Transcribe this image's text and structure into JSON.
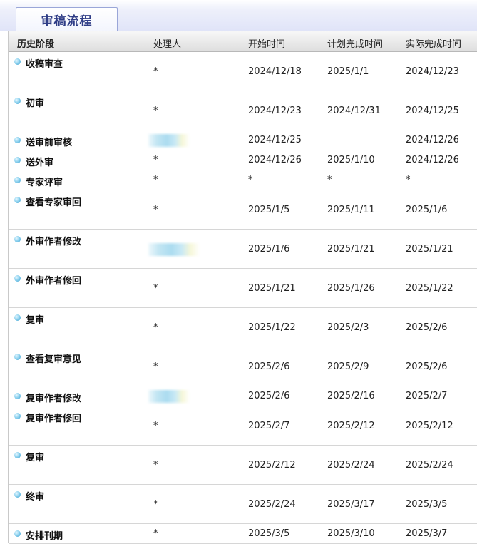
{
  "tab": {
    "label": "审稿流程"
  },
  "header": {
    "stage": "历史阶段",
    "handler": "处理人",
    "start": "开始时间",
    "planned": "计划完成时间",
    "actual": "实际完成时间"
  },
  "rows": [
    {
      "stage": "收稿审查",
      "handler": "*",
      "start": "2024/12/18",
      "planned": "2025/1/1",
      "actual": "2024/12/23"
    },
    {
      "stage": "初审",
      "handler": "*",
      "start": "2024/12/23",
      "planned": "2024/12/31",
      "actual": "2024/12/25"
    },
    {
      "stage": "送审前审核",
      "handler": "",
      "start": "2024/12/25",
      "planned": "",
      "actual": "2024/12/26"
    },
    {
      "stage": "送外审",
      "handler": "*",
      "start": "2024/12/26",
      "planned": "2025/1/10",
      "actual": "2024/12/26"
    },
    {
      "stage": "专家评审",
      "handler": "*",
      "start": "*",
      "planned": "*",
      "actual": "*"
    },
    {
      "stage": "查看专家审回",
      "handler": "*",
      "start": "2025/1/5",
      "planned": "2025/1/11",
      "actual": "2025/1/6"
    },
    {
      "stage": "外审作者修改",
      "handler": "",
      "start": "2025/1/6",
      "planned": "2025/1/21",
      "actual": "2025/1/21"
    },
    {
      "stage": "外审作者修回",
      "handler": "*",
      "start": "2025/1/21",
      "planned": "2025/1/26",
      "actual": "2025/1/22"
    },
    {
      "stage": "复审",
      "handler": "*",
      "start": "2025/1/22",
      "planned": "2025/2/3",
      "actual": "2025/2/6"
    },
    {
      "stage": "查看复审意见",
      "handler": "*",
      "start": "2025/2/6",
      "planned": "2025/2/9",
      "actual": "2025/2/6"
    },
    {
      "stage": "复审作者修改",
      "handler": "",
      "start": "2025/2/6",
      "planned": "2025/2/16",
      "actual": "2025/2/7"
    },
    {
      "stage": "复审作者修回",
      "handler": "*",
      "start": "2025/2/7",
      "planned": "2025/2/12",
      "actual": "2025/2/12"
    },
    {
      "stage": "复审",
      "handler": "*",
      "start": "2025/2/12",
      "planned": "2025/2/24",
      "actual": "2025/2/24"
    },
    {
      "stage": "终审",
      "handler": "*",
      "start": "2025/2/24",
      "planned": "2025/3/17",
      "actual": "2025/3/5"
    },
    {
      "stage": "安排刊期",
      "handler": "*",
      "start": "2025/3/5",
      "planned": "2025/3/10",
      "actual": "2025/3/7"
    }
  ]
}
